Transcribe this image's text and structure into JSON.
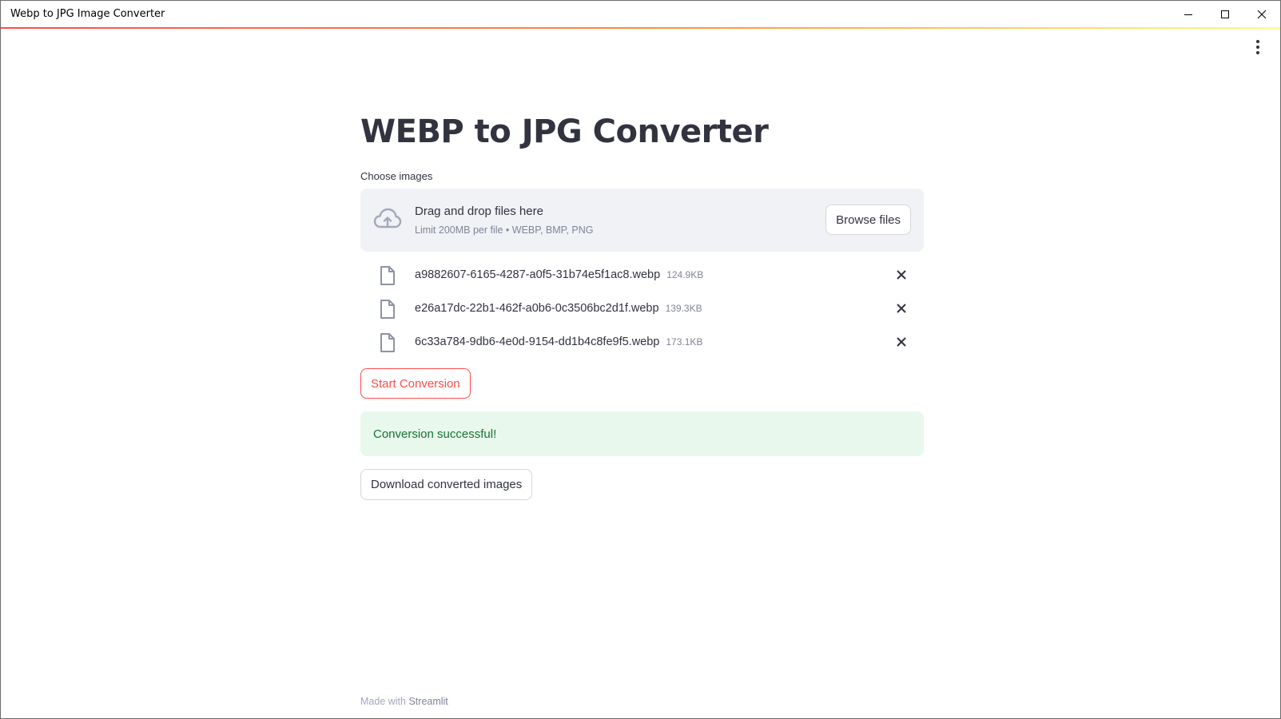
{
  "window": {
    "title": "Webp to JPG Image Converter"
  },
  "page": {
    "title": "WEBP to JPG Converter"
  },
  "uploader": {
    "label": "Choose images",
    "drag_text": "Drag and drop files here",
    "limit_text": "Limit 200MB per file • WEBP, BMP, PNG",
    "browse_label": "Browse files",
    "files": [
      {
        "name": "a9882607-6165-4287-a0f5-31b74e5f1ac8.webp",
        "size": "124.9KB"
      },
      {
        "name": "e26a17dc-22b1-462f-a0b6-0c3506bc2d1f.webp",
        "size": "139.3KB"
      },
      {
        "name": "6c33a784-9db6-4e0d-9154-dd1b4c8fe9f5.webp",
        "size": "173.1KB"
      }
    ]
  },
  "actions": {
    "start_label": "Start Conversion",
    "download_label": "Download converted images"
  },
  "alert": {
    "message": "Conversion successful!"
  },
  "footer": {
    "made_with": "Made with",
    "brand": "Streamlit"
  },
  "colors": {
    "primary": "#ff4b4b",
    "success_bg": "#e8f8ec",
    "success_text": "#177233",
    "dropzone_bg": "#f0f2f6"
  },
  "icons": {
    "upload": "cloud-upload-icon",
    "file": "file-icon",
    "remove": "close-icon",
    "menu": "kebab-menu-icon"
  }
}
